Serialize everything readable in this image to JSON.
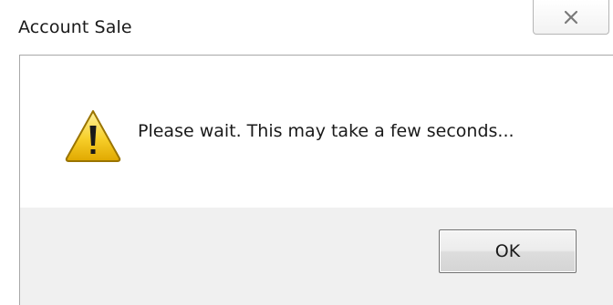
{
  "dialog": {
    "title": "Account Sale",
    "close_icon": "close-icon",
    "message": "Please wait. This may take a few seconds...",
    "message_icon": "warning-icon",
    "ok_label": "OK"
  },
  "colors": {
    "warning_fill": "#f5c518",
    "warning_stroke": "#8a6a00",
    "button_area_bg": "#f0f0f0"
  }
}
